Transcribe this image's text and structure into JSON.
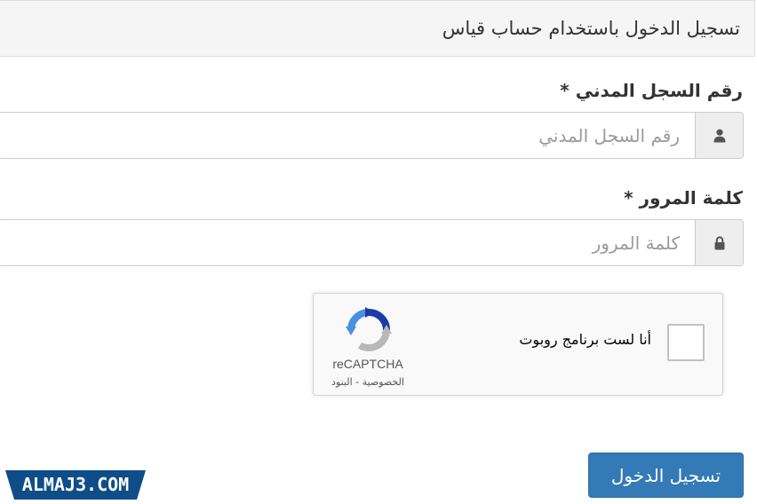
{
  "header": {
    "title": "تسجيل الدخول باستخدام حساب قياس"
  },
  "form": {
    "civil_id": {
      "label": "رقم السجل المدني *",
      "placeholder": "رقم السجل المدني",
      "value": "",
      "icon": "user-icon"
    },
    "password": {
      "label": "كلمة المرور *",
      "placeholder": "كلمة المرور",
      "value": "",
      "icon": "lock-icon"
    },
    "recaptcha": {
      "label": "أنا لست برنامج روبوت",
      "brand": "reCAPTCHA",
      "privacy": "الخصوصية",
      "separator": " - ",
      "terms": "البنود",
      "checked": false
    },
    "submit_label": "تسجيل الدخول"
  },
  "watermark": {
    "text": "ALMAJ3.COM"
  },
  "colors": {
    "primary": "#337ab7",
    "watermark_bg": "#0f4d88",
    "recaptcha_blue": "#4a90e2",
    "recaptcha_gray": "#b8b8b8"
  }
}
